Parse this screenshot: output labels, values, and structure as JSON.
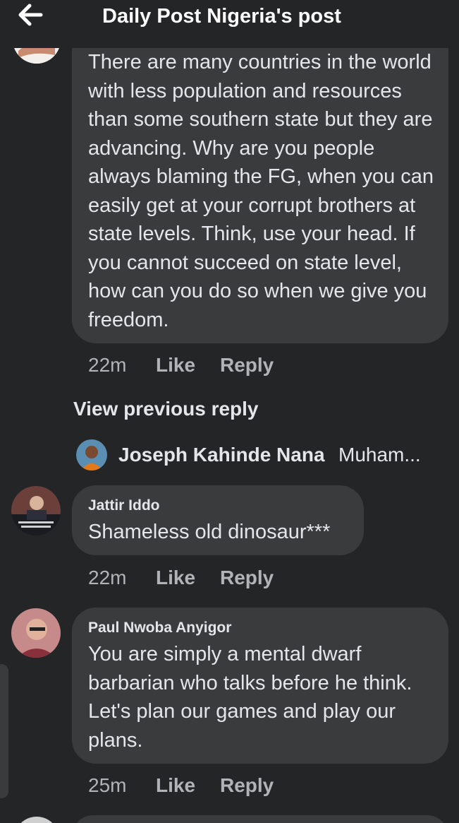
{
  "header": {
    "title": "Daily Post Nigeria's post",
    "back_icon": "arrow-left-icon"
  },
  "comments": [
    {
      "author": "",
      "text": "There are many countries in the world with less population and resources than some southern state but they are advancing. Why are you people always blaming the FG, when you can easily get at your corrupt brothers at state levels. Think, use your head. If you cannot succeed on state level, how can you do so when we give you freedom.",
      "time": "22m",
      "like_label": "Like",
      "reply_label": "Reply"
    },
    {
      "author": "Jattir Iddo",
      "text": "Shameless old dinosaur***",
      "time": "22m",
      "like_label": "Like",
      "reply_label": "Reply"
    },
    {
      "author": "Paul Nwoba Anyigor",
      "text": "You are simply a mental dwarf barbarian who talks before he think. Let's plan our games and play our plans.",
      "time": "25m",
      "like_label": "Like",
      "reply_label": "Reply"
    }
  ],
  "view_previous_reply": "View previous reply",
  "reply_preview": {
    "author": "Joseph Kahinde Nana",
    "snippet": "Muham..."
  },
  "colors": {
    "background": "#242526",
    "bubble": "#3a3b3c",
    "text_primary": "#e4e6eb",
    "text_secondary": "#b0b3b8"
  }
}
